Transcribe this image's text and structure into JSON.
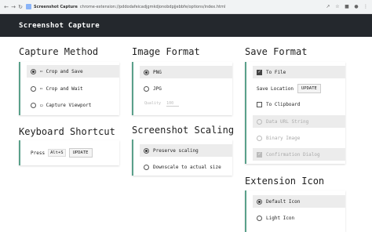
{
  "browser": {
    "tab_title": "Screenshot Capture",
    "url": "chrome-extension://pddodafeicadjgmkdjonobdpjjebbfe/options/index.html"
  },
  "header": {
    "title": "Screenshot Capture"
  },
  "capture_method": {
    "title": "Capture Method",
    "options": [
      {
        "label": "Crop and Save",
        "icon": "crop-icon",
        "selected": true
      },
      {
        "label": "Crop and Wait",
        "icon": "crop-icon",
        "selected": false
      },
      {
        "label": "Capture Viewport",
        "icon": "viewport-icon",
        "selected": false
      }
    ]
  },
  "keyboard_shortcut": {
    "title": "Keyboard Shortcut",
    "press_label": "Press",
    "keys": "Alt+S",
    "update_label": "UPDATE"
  },
  "image_format": {
    "title": "Image Format",
    "options": [
      {
        "label": "PNG",
        "selected": true
      },
      {
        "label": "JPG",
        "selected": false
      }
    ],
    "quality_label": "Quality",
    "quality_value": "100"
  },
  "screenshot_scaling": {
    "title": "Screenshot Scaling",
    "options": [
      {
        "label": "Preserve scaling",
        "selected": true
      },
      {
        "label": "Downscale to actual size",
        "selected": false
      }
    ]
  },
  "save_format": {
    "title": "Save Format",
    "to_file_label": "To File",
    "save_location_label": "Save Location",
    "update_label": "UPDATE",
    "to_clipboard_label": "To Clipboard",
    "sub_options": [
      {
        "label": "Data URL String",
        "selected": true
      },
      {
        "label": "Binary Image",
        "selected": false
      }
    ],
    "confirmation_label": "Confirmation Dialog"
  },
  "extension_icon": {
    "title": "Extension Icon",
    "options": [
      {
        "label": "Default Icon",
        "selected": true
      },
      {
        "label": "Light Icon",
        "selected": false
      }
    ]
  },
  "colors": {
    "header_bg": "#24282d",
    "accent": "#5aa08a"
  }
}
